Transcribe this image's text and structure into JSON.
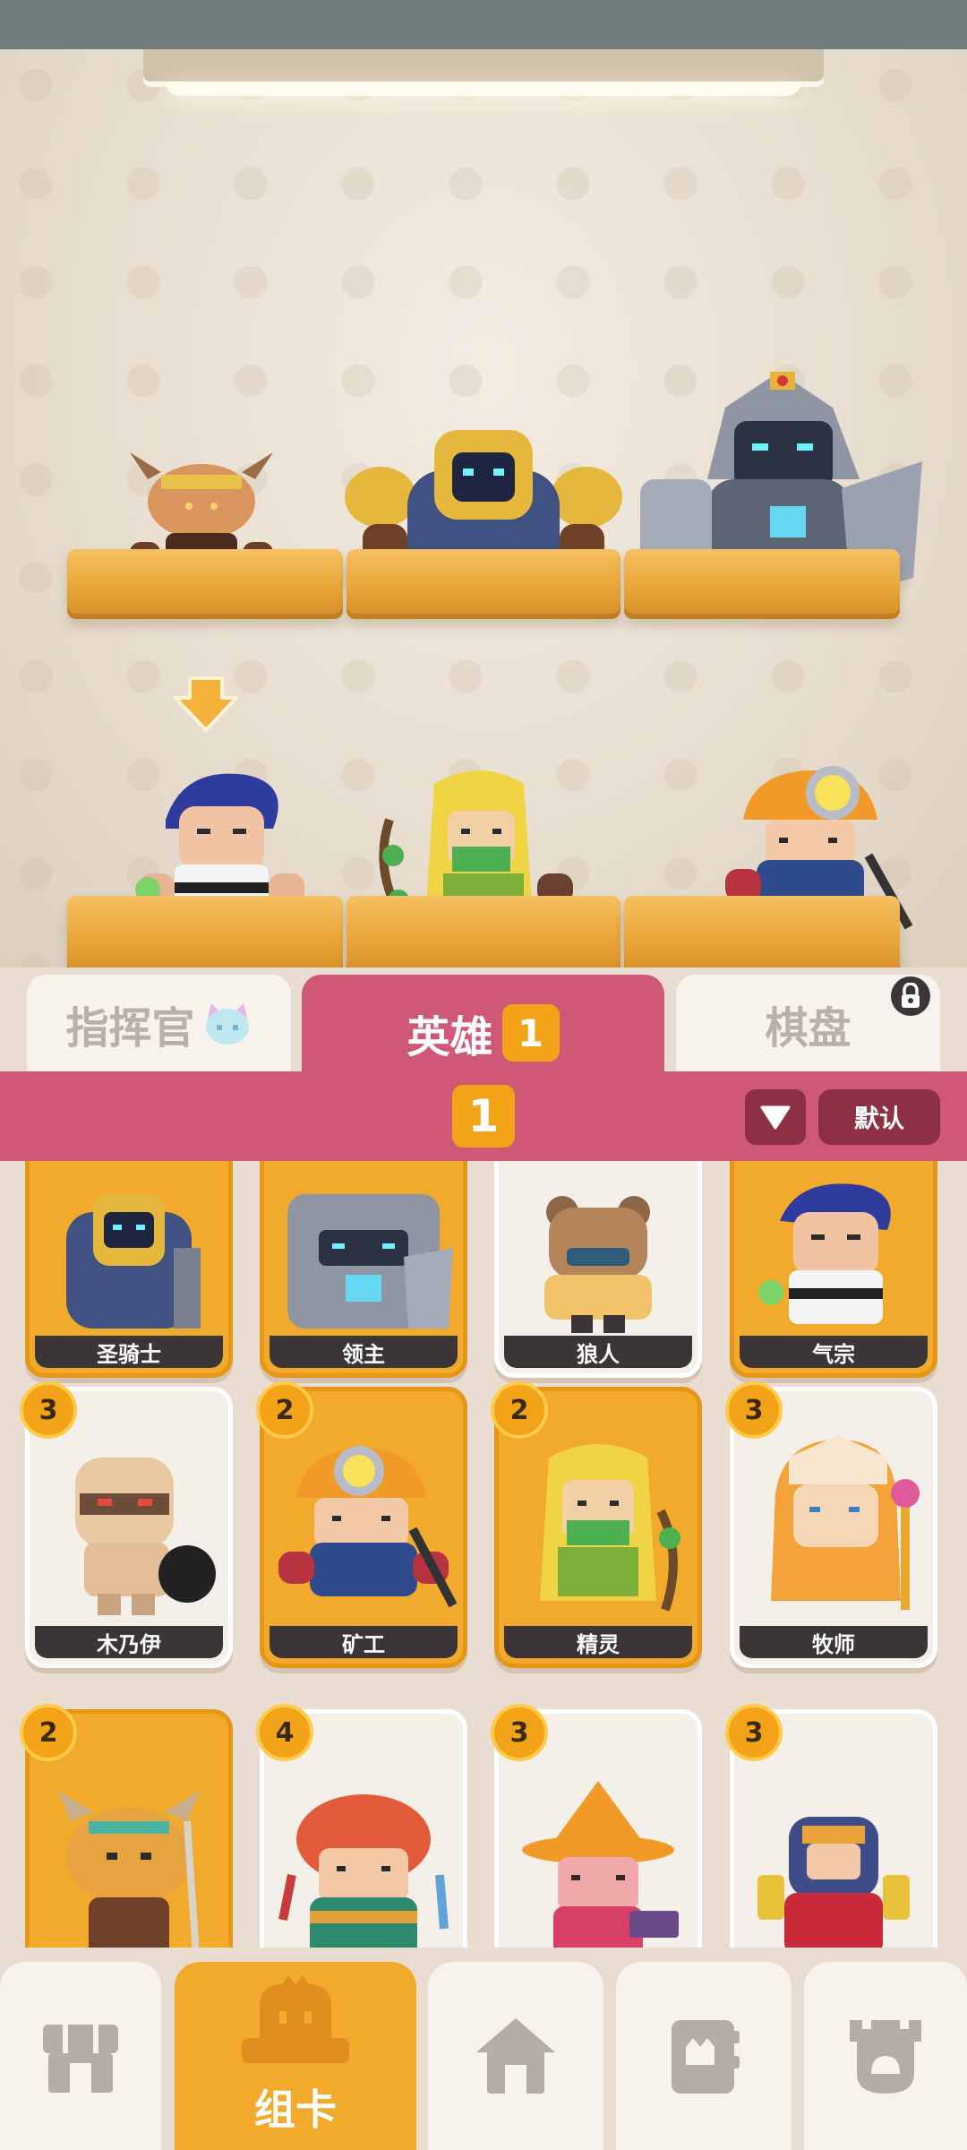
{
  "tabs": {
    "commander": "指挥官",
    "heroes": "英雄",
    "heroes_badge": "1",
    "board": "棋盘"
  },
  "filter": {
    "badge": "1",
    "sort_label": "默认"
  },
  "top_row_cards": [
    {
      "name": "圣骑士"
    },
    {
      "name": "领主"
    },
    {
      "name": "狼人"
    },
    {
      "name": "气宗"
    }
  ],
  "middle_row_cards": [
    {
      "name": "木乃伊",
      "cost": "3"
    },
    {
      "name": "矿工",
      "cost": "2"
    },
    {
      "name": "精灵",
      "cost": "2"
    },
    {
      "name": "牧师",
      "cost": "3"
    }
  ],
  "bottom_row_cards": [
    {
      "cost": "2"
    },
    {
      "cost": "4"
    },
    {
      "cost": "3"
    },
    {
      "cost": "3"
    }
  ],
  "nav": {
    "deck_label": "组卡"
  },
  "colors": {
    "accent_pink": "#cf5877",
    "accent_orange": "#f1aa2c",
    "badge_orange": "#f3a318",
    "name_plate": "#3c3537"
  }
}
